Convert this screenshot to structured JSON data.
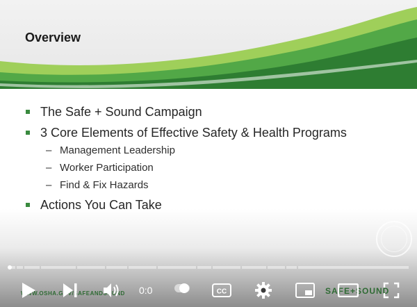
{
  "slide": {
    "title": "Overview",
    "bullets": [
      {
        "text": "The Safe + Sound Campaign"
      },
      {
        "text": "3 Core Elements of Effective Safety & Health Programs",
        "sub": [
          "Management Leadership",
          "Worker Participation",
          "Find & Fix Hazards"
        ]
      },
      {
        "text": "Actions You Can Take"
      }
    ],
    "dash": "–",
    "footer_url": "WWW.OSHA.GOV/SAFEANDSOUND",
    "footer_brand": "SAFE+SOUND"
  },
  "player": {
    "time": "0:0",
    "progress_fraction": 0.0,
    "controls": [
      "play-icon",
      "next-icon",
      "volume-icon",
      "autoplay-toggle",
      "captions-icon",
      "settings-icon",
      "miniplayer-icon",
      "theater-icon",
      "fullscreen-icon"
    ],
    "cc_label": "CC"
  },
  "colors": {
    "brand_green": "#3a8a3f",
    "light_green": "#8cc63f",
    "dark_green": "#2f6b34"
  }
}
